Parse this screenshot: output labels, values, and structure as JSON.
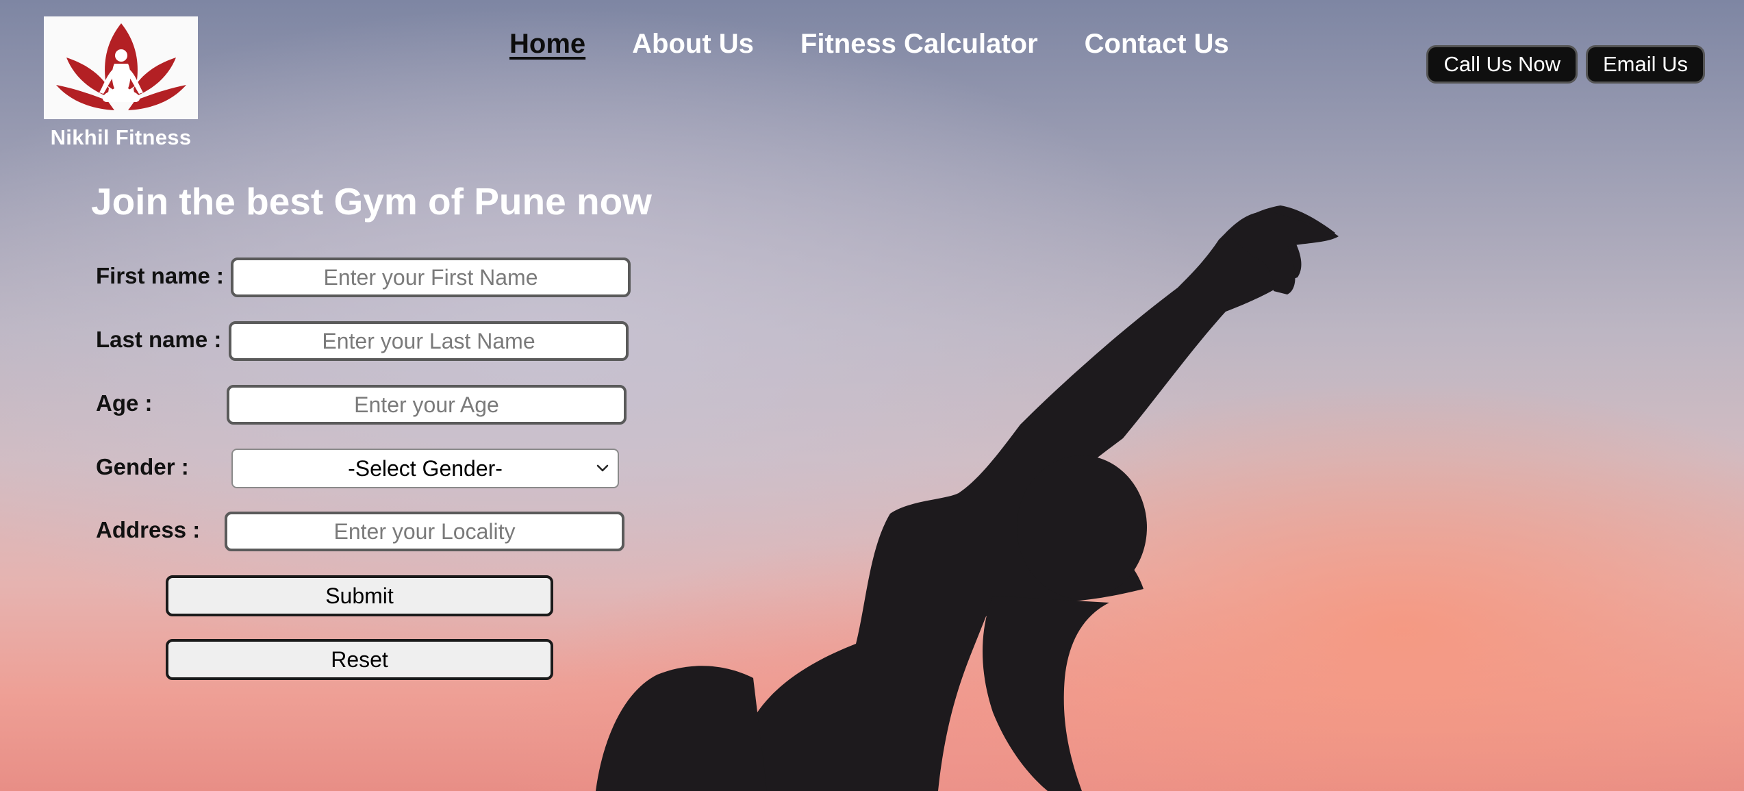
{
  "brand": {
    "name": "Nikhil Fitness",
    "logo_icon": "lotus-meditation-icon",
    "logo_color": "#b32024"
  },
  "nav": {
    "items": [
      {
        "label": "Home",
        "active": true
      },
      {
        "label": "About Us",
        "active": false
      },
      {
        "label": "Fitness Calculator",
        "active": false
      },
      {
        "label": "Contact Us",
        "active": false
      }
    ]
  },
  "header_buttons": {
    "call": "Call Us Now",
    "email": "Email Us"
  },
  "hero": {
    "headline": "Join the best Gym of Pune now"
  },
  "form": {
    "first_name": {
      "label": "First name :",
      "placeholder": "Enter your First Name",
      "value": ""
    },
    "last_name": {
      "label": "Last name :",
      "placeholder": "Enter your Last Name",
      "value": ""
    },
    "age": {
      "label": "Age :",
      "placeholder": "Enter your Age",
      "value": ""
    },
    "gender": {
      "label": "Gender :",
      "selected": "-Select Gender-"
    },
    "address": {
      "label": "Address :",
      "placeholder": "Enter your Locality",
      "value": ""
    },
    "submit_label": "Submit",
    "reset_label": "Reset"
  },
  "colors": {
    "text_light": "#ffffff",
    "text_dark": "#111111",
    "button_dark": "#0f0f0f",
    "silhouette": "#1d1a1d"
  }
}
